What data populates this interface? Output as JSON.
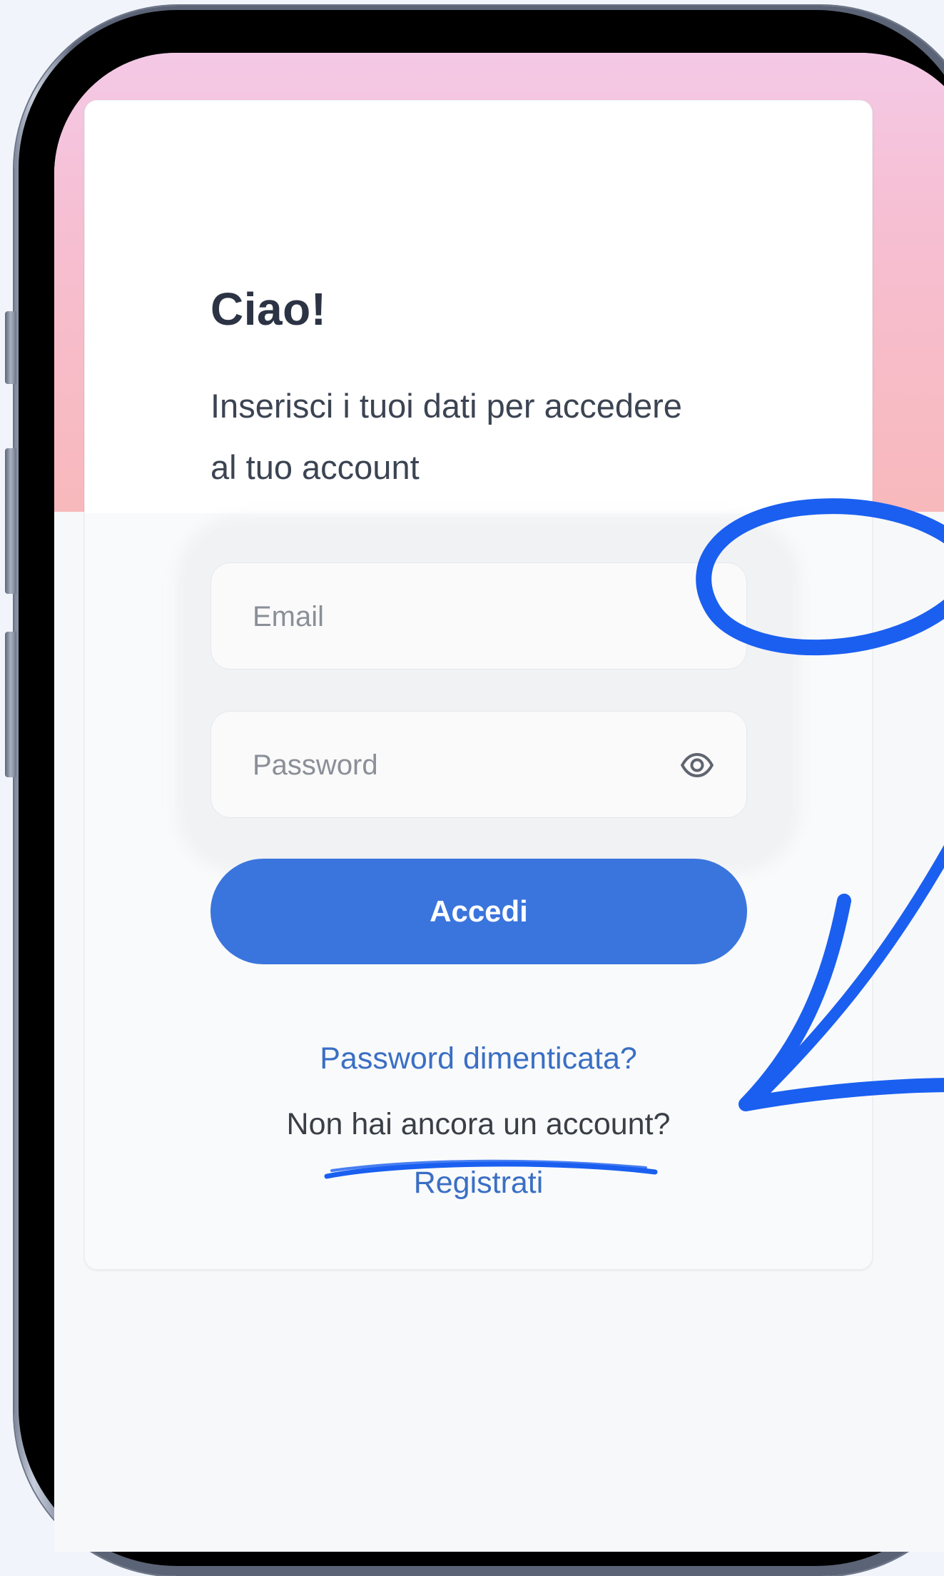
{
  "login": {
    "title": "Ciao!",
    "subtitle": "Inserisci i tuoi dati per accedere al tuo account",
    "email_placeholder": "Email",
    "password_placeholder": "Password",
    "submit_label": "Accedi",
    "forgot_password": "Password dimenticata?",
    "no_account_prompt": "Non hai ancora un account?",
    "register_link": "Registrati"
  },
  "colors": {
    "primary": "#3a75dd",
    "link": "#3a6fc4",
    "annotation": "#1a5ff0",
    "header_gradient_top": "#f4c9e6",
    "header_gradient_bottom": "#f8b9bc"
  }
}
